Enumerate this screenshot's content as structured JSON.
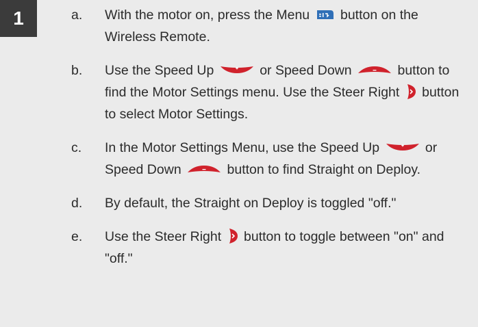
{
  "step": {
    "number": "1"
  },
  "items": [
    {
      "letter": "a.",
      "pre": "With the motor on, press the Menu",
      "post": "button on the Wireless Remote."
    },
    {
      "letter": "b.",
      "pre": "Use the Speed Up",
      "mid1": "or Speed Down",
      "mid2": "button to find the Motor Settings menu. Use the Steer Right",
      "post": "button to select Motor Settings."
    },
    {
      "letter": "c.",
      "pre": "In the Motor Settings Menu, use the Speed Up",
      "mid1": "or Speed Down",
      "post": "button to find Straight on Deploy."
    },
    {
      "letter": "d.",
      "text": "By default, the Straight on Deploy is toggled \"off.\""
    },
    {
      "letter": "e.",
      "pre": "Use the Steer Right",
      "post": "button to toggle between \"on\" and \"off.\""
    }
  ],
  "icons": {
    "menu": "menu-button-icon",
    "speed_up": "speed-up-button-icon",
    "speed_down": "speed-down-button-icon",
    "steer_right": "steer-right-button-icon"
  },
  "colors": {
    "panel_bg": "#ebebeb",
    "badge_bg": "#3b3b3b",
    "remote_red": "#d0222c",
    "menu_blue": "#2f6fb7"
  }
}
